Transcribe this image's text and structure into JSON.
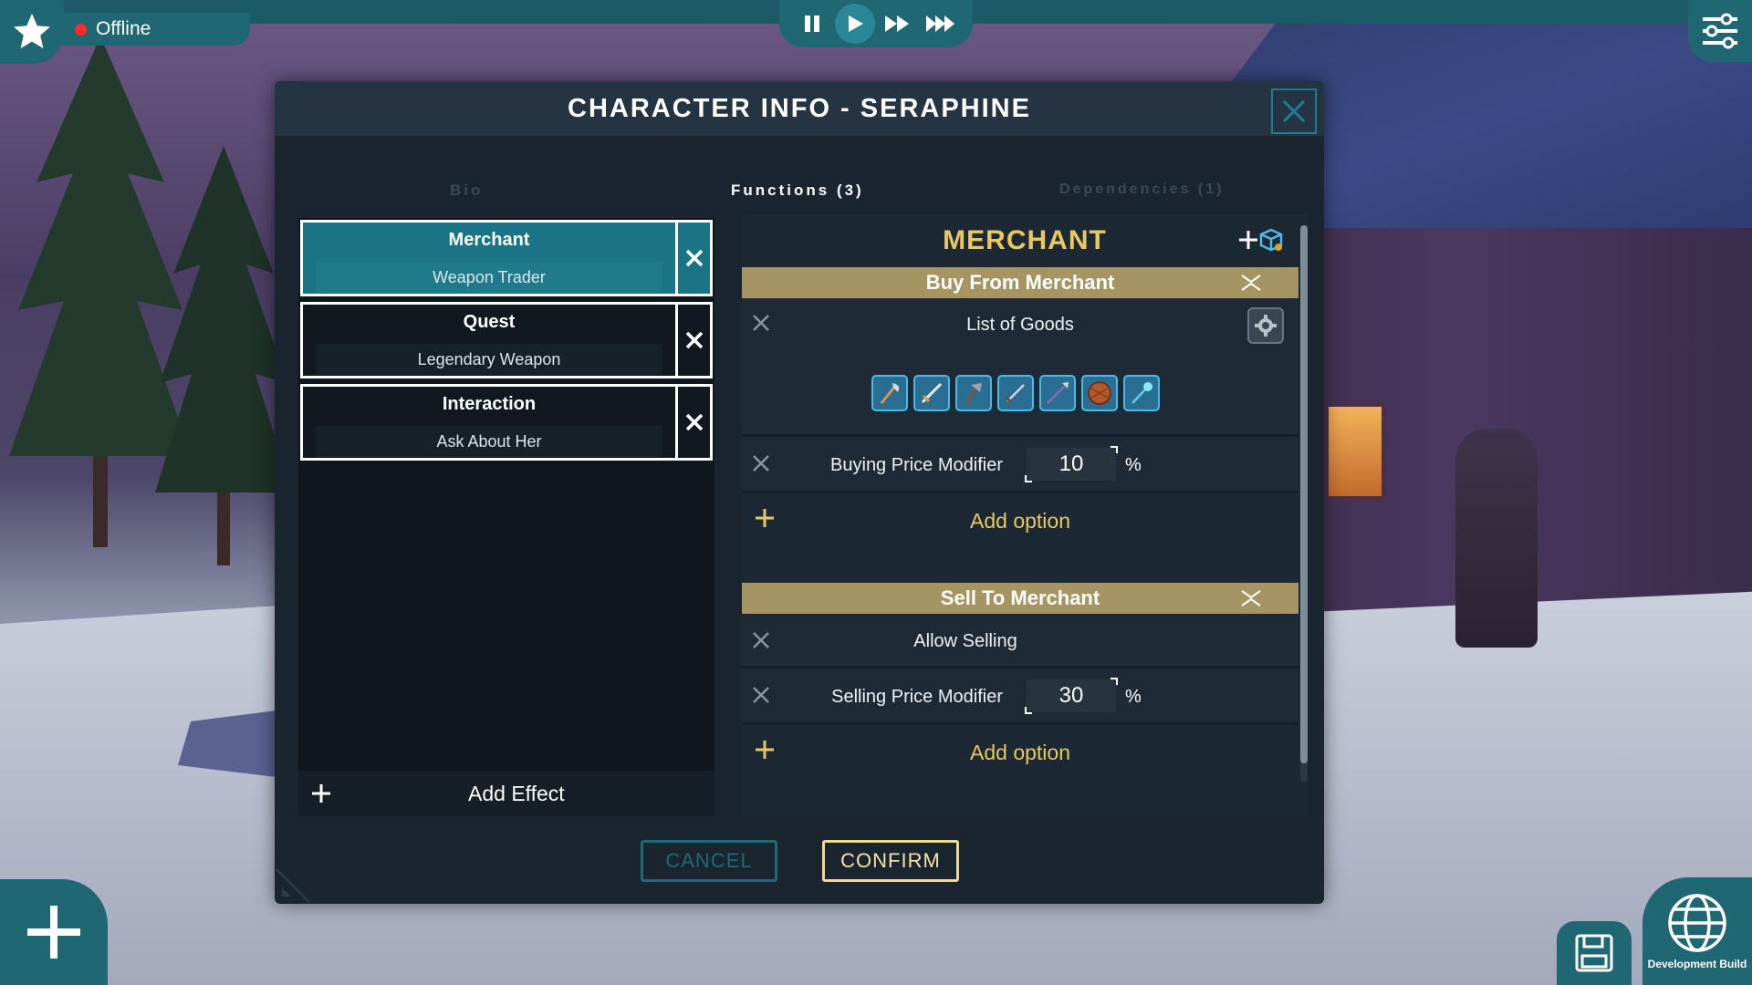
{
  "hud": {
    "status": "Offline",
    "status_color": "#ff2a2a",
    "playback": [
      "pause-icon",
      "play-icon",
      "fast-forward-icon",
      "faster-forward-icon"
    ],
    "dev_build_label": "Development Build"
  },
  "dialog": {
    "title": "CHARACTER INFO - SERAPHINE",
    "tabs": {
      "bio": "Bio",
      "functions": "Functions (3)",
      "dependencies": "Dependencies (1)"
    },
    "functions": [
      {
        "name": "Merchant",
        "subtitle": "Weapon Trader",
        "selected": true
      },
      {
        "name": "Quest",
        "subtitle": "Legendary Weapon",
        "selected": false
      },
      {
        "name": "Interaction",
        "subtitle": "Ask About Her",
        "selected": false
      }
    ],
    "add_effect": "Add Effect",
    "detail": {
      "title": "MERCHANT",
      "buy_section": {
        "title": "Buy From Merchant",
        "goods_label": "List of Goods",
        "goods": [
          "axe-icon",
          "sword-icon",
          "war-axe-icon",
          "dagger-icon",
          "spear-icon",
          "shield-icon",
          "magic-staff-icon"
        ],
        "price_label": "Buying Price Modifier",
        "price_value": "10",
        "unit": "%",
        "add_option": "Add option"
      },
      "sell_section": {
        "title": "Sell To Merchant",
        "toggle_label": "Allow Selling",
        "price_label": "Selling Price Modifier",
        "price_value": "30",
        "unit": "%",
        "add_option": "Add option"
      }
    },
    "buttons": {
      "cancel": "CANCEL",
      "confirm": "CONFIRM"
    }
  },
  "colors": {
    "hud_teal": "#1e6773",
    "selected_item": "#1b7485",
    "title_gold": "#e8c862",
    "section_header": "#a69563"
  }
}
